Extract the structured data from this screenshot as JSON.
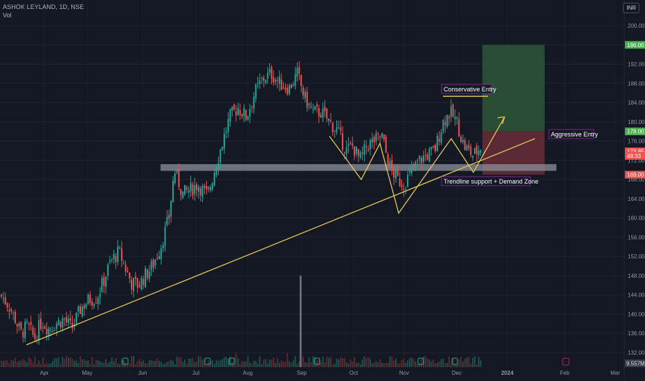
{
  "header": {
    "symbol": "ASHOK LEYLAND, 1D, NSE",
    "volume_label": "Vol",
    "currency": "INR"
  },
  "colors": {
    "background": "#141823",
    "up": "#26a69a",
    "down": "#ef5350",
    "annotation": "#e8c95a",
    "target_zone": "#2f5e3b",
    "stop_zone": "#6b2e3a",
    "demand_zone": "#8a8f9c"
  },
  "chart_data": {
    "type": "candlestick",
    "y_axis": {
      "range": [
        130,
        202
      ],
      "ticks": [
        "200.00",
        "196.00",
        "192.00",
        "188.00",
        "184.00",
        "180.00",
        "176.00",
        "172.00",
        "168.00",
        "164.00",
        "160.00",
        "156.00",
        "152.00",
        "148.00",
        "144.00",
        "140.00",
        "136.00",
        "132.00"
      ]
    },
    "x_axis": {
      "ticks": [
        "Apr",
        "May",
        "Jun",
        "Jul",
        "Aug",
        "Sep",
        "Oct",
        "Nov",
        "Dec",
        "2024",
        "Feb",
        "Mar"
      ]
    },
    "price_badges": [
      {
        "label": "196.00",
        "value": 196.0,
        "color": "#4caf50"
      },
      {
        "label": "178.00",
        "value": 178.0,
        "color": "#4caf50"
      },
      {
        "label": "173.85",
        "value": 173.85,
        "color": "#ef5350"
      },
      {
        "label": "48:33",
        "value": 172.9,
        "color": "#ef5350"
      },
      {
        "label": "169.00",
        "value": 169.0,
        "color": "#ef5350"
      }
    ],
    "volume_badge": "9.557M",
    "approx_closes": [
      {
        "date": "Apr",
        "close": 143
      },
      {
        "date": "Apr-mid",
        "close": 138
      },
      {
        "date": "May",
        "close": 142
      },
      {
        "date": "May-end",
        "close": 155
      },
      {
        "date": "Jun-start",
        "close": 146
      },
      {
        "date": "Jun-end",
        "close": 158
      },
      {
        "date": "Jul-start",
        "close": 169
      },
      {
        "date": "Jul-mid",
        "close": 166
      },
      {
        "date": "Jul-end",
        "close": 181
      },
      {
        "date": "Aug-start",
        "close": 184
      },
      {
        "date": "Aug-mid",
        "close": 189
      },
      {
        "date": "Sep",
        "close": 186
      },
      {
        "date": "Sep-end",
        "close": 177
      },
      {
        "date": "Oct",
        "close": 175
      },
      {
        "date": "Oct-end",
        "close": 167
      },
      {
        "date": "Nov",
        "close": 168
      },
      {
        "date": "Nov-end",
        "close": 179
      },
      {
        "date": "Dec-start",
        "close": 184
      },
      {
        "date": "Dec-mid",
        "close": 173.85
      }
    ],
    "annotations": [
      {
        "label": "Conservative Entry"
      },
      {
        "label": "Aggressive Entry"
      },
      {
        "label": "Trendline support + Demand Zone"
      }
    ],
    "zones": {
      "target": {
        "from": 178,
        "to": 196
      },
      "stop": {
        "from": 169,
        "to": 178
      },
      "demand": {
        "from": 169.8,
        "to": 171.2
      }
    }
  }
}
